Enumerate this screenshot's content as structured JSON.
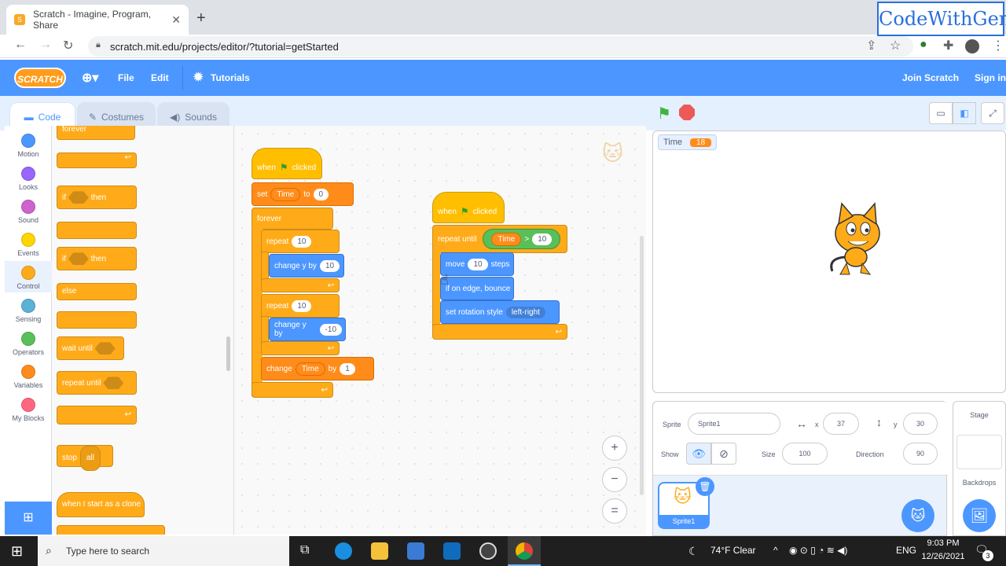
{
  "browser": {
    "tab_title": "Scratch - Imagine, Program, Share",
    "new_tab": "+",
    "url": "scratch.mit.edu/projects/editor/?tutorial=getStarted",
    "overlay": "CodeWithGen"
  },
  "menu": {
    "logo": "SCRATCH",
    "file": "File",
    "edit": "Edit",
    "tutorials": "Tutorials",
    "join": "Join Scratch",
    "signin": "Sign in"
  },
  "editor_tabs": {
    "code": "Code",
    "costumes": "Costumes",
    "sounds": "Sounds"
  },
  "categories": [
    {
      "label": "Motion",
      "color": "#4c97ff"
    },
    {
      "label": "Looks",
      "color": "#9966ff"
    },
    {
      "label": "Sound",
      "color": "#cf63cf"
    },
    {
      "label": "Events",
      "color": "#ffd500"
    },
    {
      "label": "Control",
      "color": "#ffab19"
    },
    {
      "label": "Sensing",
      "color": "#5cb1d6"
    },
    {
      "label": "Operators",
      "color": "#59c059"
    },
    {
      "label": "Variables",
      "color": "#ff8c1a"
    },
    {
      "label": "My Blocks",
      "color": "#ff6680"
    }
  ],
  "palette": {
    "forever": "forever",
    "if": "if",
    "then": "then",
    "if2": "if",
    "then2": "then",
    "else": "else",
    "wait_until": "wait until",
    "repeat_until": "repeat until",
    "stop": "stop",
    "stop_opt": "all",
    "clone": "when I start as a clone"
  },
  "script1": {
    "when": "when",
    "clicked": "clicked",
    "set": "set",
    "set_var": "Time",
    "to": "to",
    "set_val": "0",
    "forever": "forever",
    "repeat1": "repeat",
    "repeat1_val": "10",
    "change1": "change y by",
    "change1_val": "10",
    "repeat2": "repeat",
    "repeat2_val": "10",
    "change2": "change y by",
    "change2_val": "-10",
    "change3": "change",
    "change3_var": "Time",
    "by": "by",
    "change3_val": "1"
  },
  "script2": {
    "when": "when",
    "clicked": "clicked",
    "repeat_until": "repeat until",
    "op_var": "Time",
    "op_sym": ">",
    "op_val": "10",
    "move": "move",
    "move_val": "10",
    "steps": "steps",
    "bounce": "if on edge, bounce",
    "rotation": "set rotation style",
    "rotation_opt": "left-right"
  },
  "zoom": {
    "in": "+",
    "out": "−",
    "reset": "="
  },
  "stage": {
    "monitor_label": "Time",
    "monitor_value": "18"
  },
  "sprite_info": {
    "sprite_label": "Sprite",
    "sprite_name": "Sprite1",
    "x_label": "x",
    "x": "37",
    "y_label": "y",
    "y": "30",
    "show_label": "Show",
    "size_label": "Size",
    "size": "100",
    "direction_label": "Direction",
    "direction": "90",
    "thumb_name": "Sprite1"
  },
  "stage_pane": {
    "label": "Stage",
    "backdrops": "Backdrops"
  },
  "taskbar": {
    "search": "Type here to search",
    "weather": "74°F Clear",
    "lang": "ENG",
    "time": "9:03 PM",
    "date": "12/26/2021",
    "notif": "3"
  }
}
